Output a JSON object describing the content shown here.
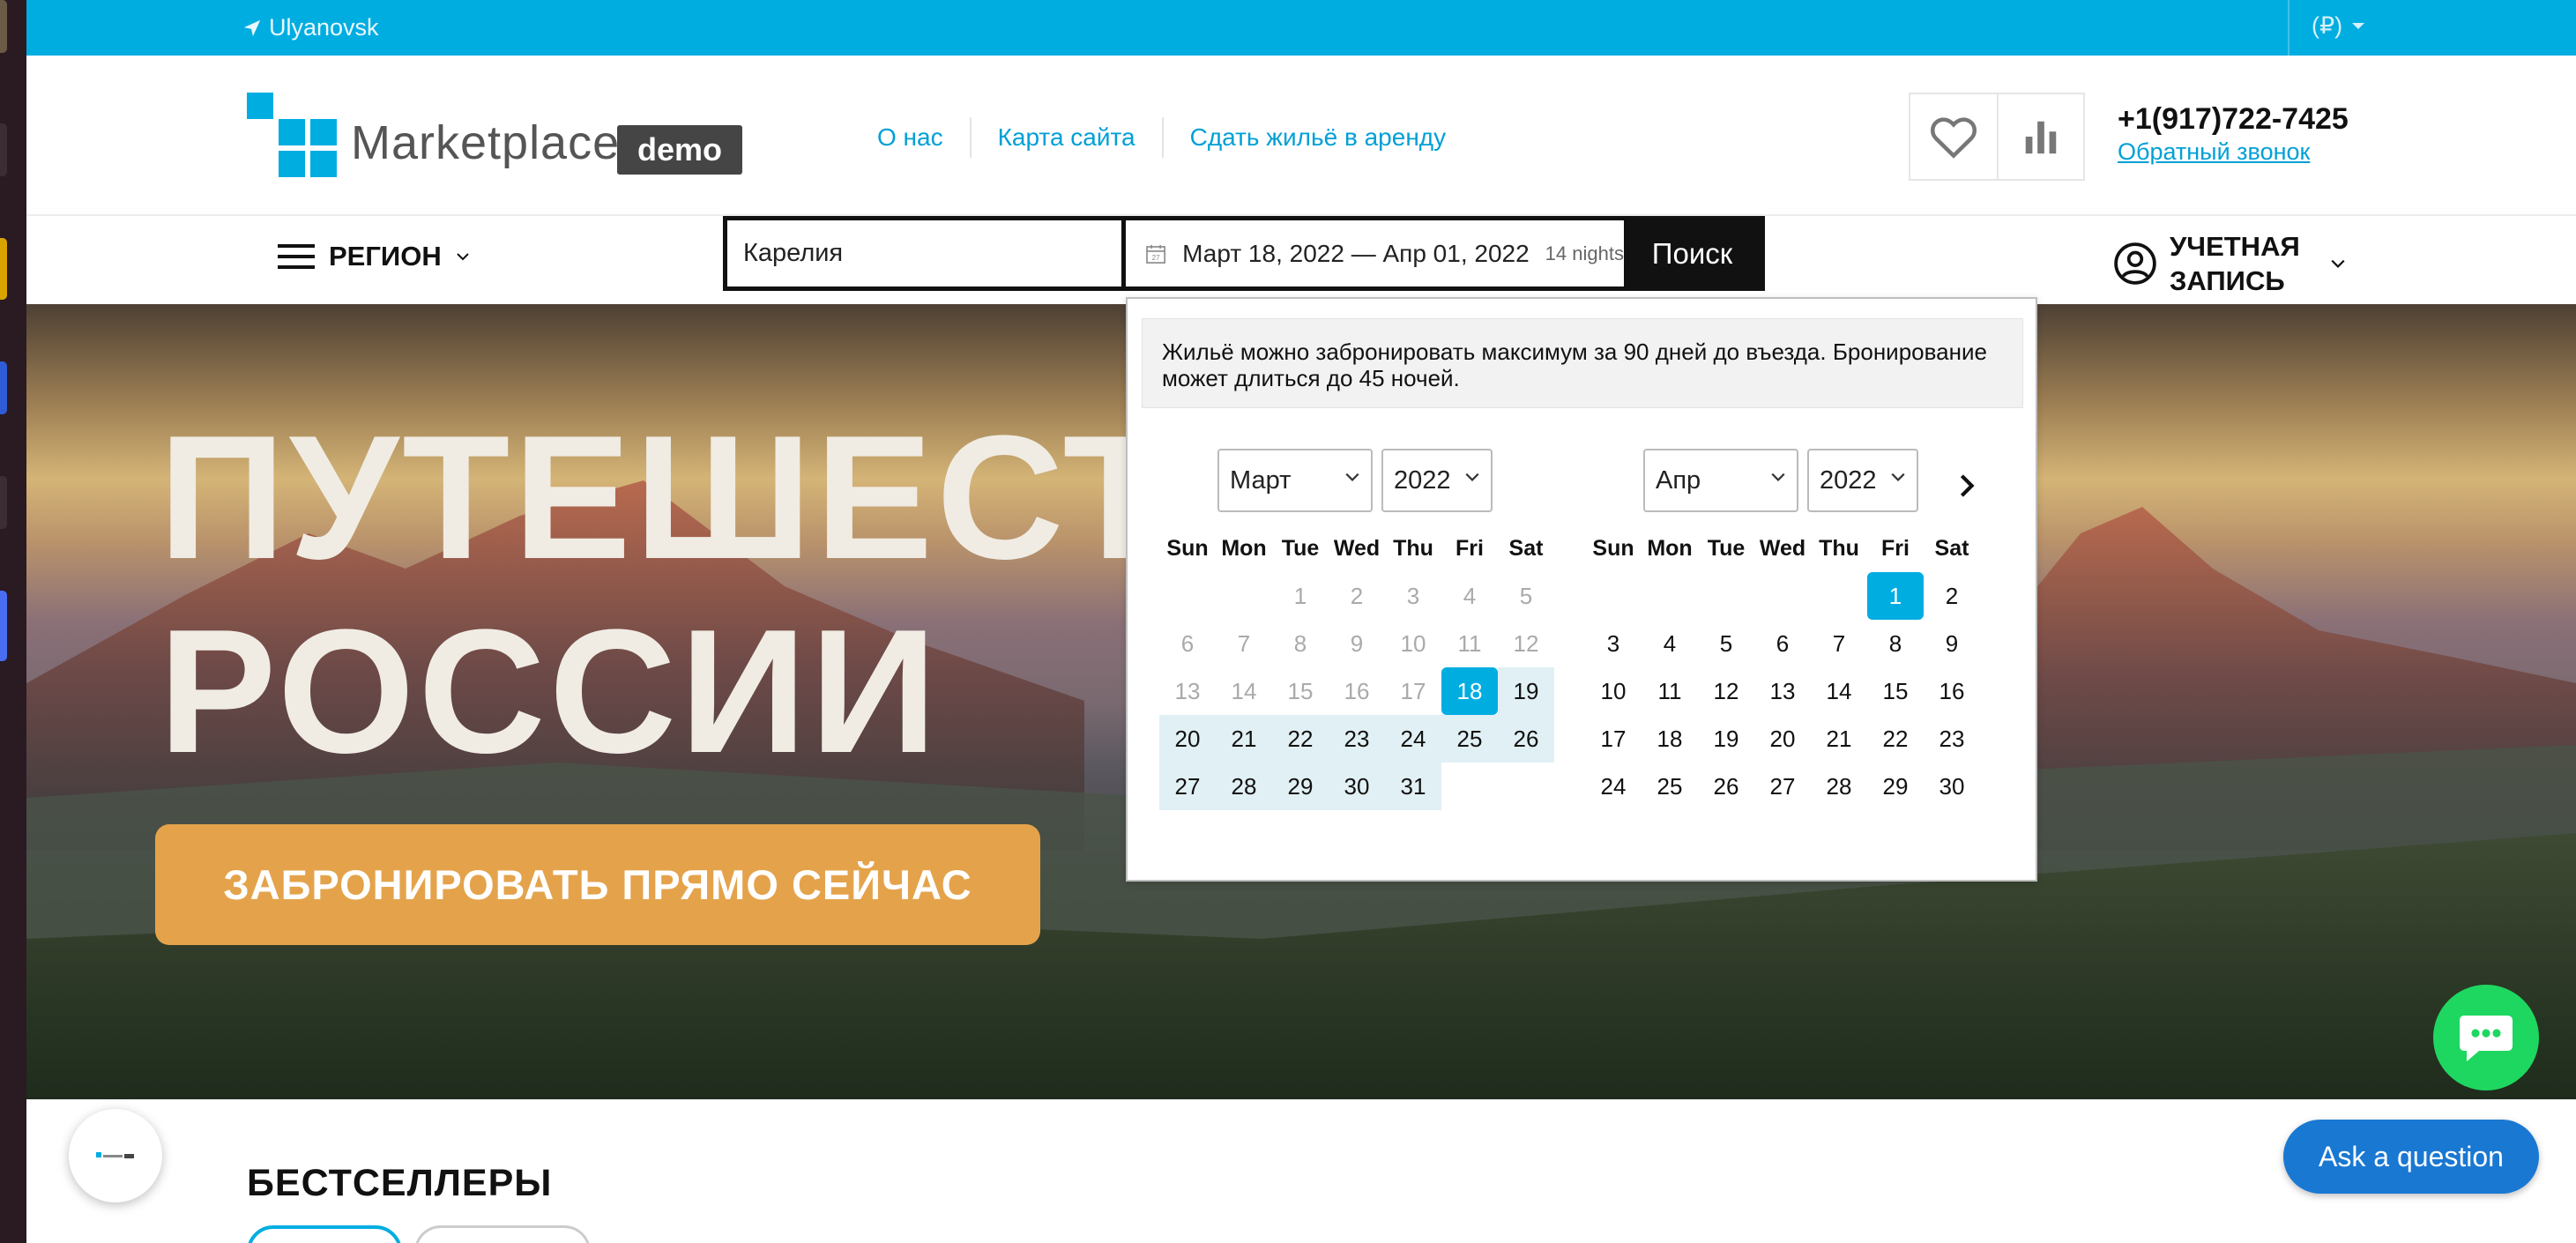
{
  "topbar": {
    "location": "Ulyanovsk",
    "currency": "(₽)"
  },
  "header": {
    "logo_name": "Marketplace",
    "logo_badge": "demo",
    "nav": [
      "О нас",
      "Карта сайта",
      "Сдать жильё в аренду"
    ],
    "phone": "+1(917)722-7425",
    "callback": "Обратный звонок"
  },
  "navrow": {
    "region": "РЕГИОН",
    "search_value": "Карелия",
    "dates": "Март 18, 2022 — Апр 01, 2022",
    "nights_count": "14",
    "nights_label": "nights",
    "search_button": "Поиск",
    "account_line1": "УЧЕТНАЯ",
    "account_line2": "ЗАПИСЬ"
  },
  "hero": {
    "title_line1": "ПУТЕШЕСТВ",
    "title_line2": "РОССИИ",
    "cta": "ЗАБРОНИРОВАТЬ ПРЯМО СЕЙЧАС"
  },
  "datepicker": {
    "notice": "Жильё можно забронировать максимум за 90 дней до въезда. Бронирование может длиться до 45 ночей.",
    "weekdays": [
      "Sun",
      "Mon",
      "Tue",
      "Wed",
      "Thu",
      "Fri",
      "Sat"
    ],
    "left": {
      "month": "Март",
      "year": "2022",
      "weeks": [
        [
          {
            "d": ""
          },
          {
            "d": ""
          },
          {
            "d": "1",
            "s": "dis"
          },
          {
            "d": "2",
            "s": "dis"
          },
          {
            "d": "3",
            "s": "dis"
          },
          {
            "d": "4",
            "s": "dis"
          },
          {
            "d": "5",
            "s": "dis"
          }
        ],
        [
          {
            "d": "6",
            "s": "dis"
          },
          {
            "d": "7",
            "s": "dis"
          },
          {
            "d": "8",
            "s": "dis"
          },
          {
            "d": "9",
            "s": "dis"
          },
          {
            "d": "10",
            "s": "dis"
          },
          {
            "d": "11",
            "s": "dis"
          },
          {
            "d": "12",
            "s": "dis"
          }
        ],
        [
          {
            "d": "13",
            "s": "dis"
          },
          {
            "d": "14",
            "s": "dis"
          },
          {
            "d": "15",
            "s": "dis"
          },
          {
            "d": "16",
            "s": "dis"
          },
          {
            "d": "17",
            "s": "dis"
          },
          {
            "d": "18",
            "s": "sel"
          },
          {
            "d": "19",
            "s": "inr"
          }
        ],
        [
          {
            "d": "20",
            "s": "inr"
          },
          {
            "d": "21",
            "s": "inr"
          },
          {
            "d": "22",
            "s": "inr"
          },
          {
            "d": "23",
            "s": "inr"
          },
          {
            "d": "24",
            "s": "inr"
          },
          {
            "d": "25",
            "s": "inr"
          },
          {
            "d": "26",
            "s": "inr"
          }
        ],
        [
          {
            "d": "27",
            "s": "inr"
          },
          {
            "d": "28",
            "s": "inr"
          },
          {
            "d": "29",
            "s": "inr"
          },
          {
            "d": "30",
            "s": "inr"
          },
          {
            "d": "31",
            "s": "inr"
          },
          {
            "d": ""
          },
          {
            "d": ""
          }
        ]
      ]
    },
    "right": {
      "month": "Апр",
      "year": "2022",
      "weeks": [
        [
          {
            "d": ""
          },
          {
            "d": ""
          },
          {
            "d": ""
          },
          {
            "d": ""
          },
          {
            "d": ""
          },
          {
            "d": "1",
            "s": "sel"
          },
          {
            "d": "2"
          }
        ],
        [
          {
            "d": "3"
          },
          {
            "d": "4"
          },
          {
            "d": "5"
          },
          {
            "d": "6"
          },
          {
            "d": "7"
          },
          {
            "d": "8"
          },
          {
            "d": "9"
          }
        ],
        [
          {
            "d": "10"
          },
          {
            "d": "11"
          },
          {
            "d": "12"
          },
          {
            "d": "13"
          },
          {
            "d": "14"
          },
          {
            "d": "15"
          },
          {
            "d": "16"
          }
        ],
        [
          {
            "d": "17"
          },
          {
            "d": "18"
          },
          {
            "d": "19"
          },
          {
            "d": "20"
          },
          {
            "d": "21"
          },
          {
            "d": "22"
          },
          {
            "d": "23"
          }
        ],
        [
          {
            "d": "24"
          },
          {
            "d": "25"
          },
          {
            "d": "26"
          },
          {
            "d": "27"
          },
          {
            "d": "28"
          },
          {
            "d": "29"
          },
          {
            "d": "30"
          }
        ]
      ]
    }
  },
  "sections": {
    "bestsellers": "БЕСТСЕЛЛЕРЫ"
  },
  "widgets": {
    "ask": "Ask a question"
  },
  "colors": {
    "accent": "#00ade1",
    "cta": "#e4a34b",
    "chat": "#1ed760",
    "ask": "#1978d2"
  },
  "icons": [
    "location-arrow-icon",
    "chevron-down-icon",
    "heart-icon",
    "bar-chart-icon",
    "menu-icon",
    "calendar-icon",
    "user-circle-icon",
    "chevron-right-icon",
    "chat-icon"
  ]
}
